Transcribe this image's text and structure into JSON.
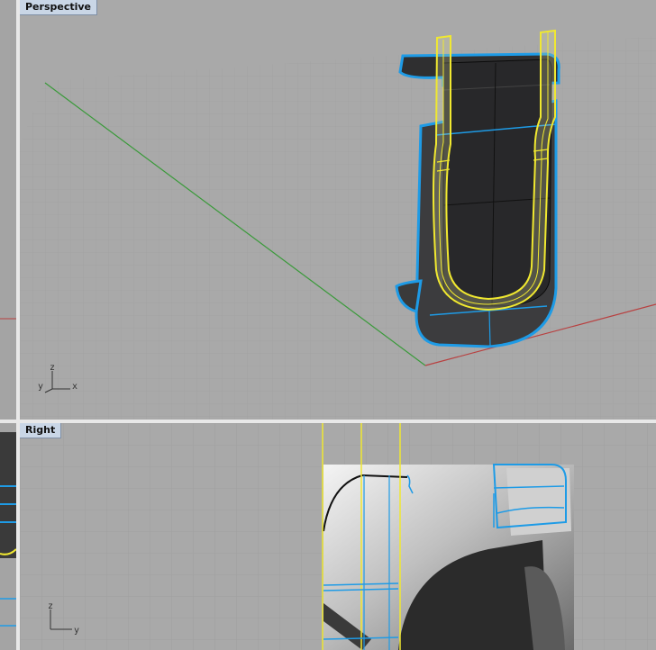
{
  "viewports": {
    "perspective": {
      "label": "Perspective",
      "axis_x": "x",
      "axis_y": "y",
      "axis_z": "z"
    },
    "right": {
      "label": "Right",
      "axis_y": "y",
      "axis_z": "z"
    }
  },
  "colors": {
    "background": "#a9a9a9",
    "grid": "#9c9c9c",
    "x_axis": "#b84040",
    "y_axis": "#3a9a3a",
    "selected": "#f0e830",
    "highlight": "#1e9be6",
    "label_bg": "#c9d6e6"
  }
}
